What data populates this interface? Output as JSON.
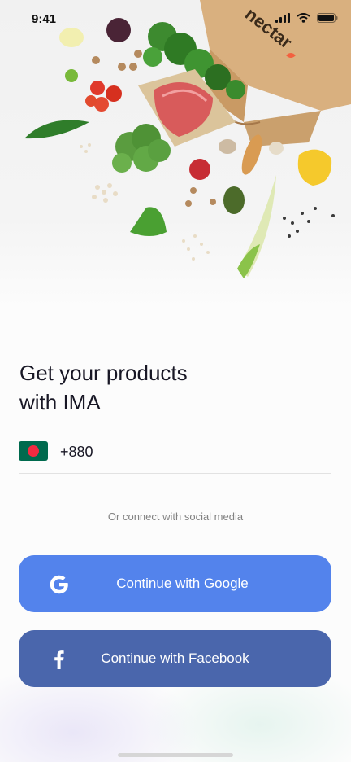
{
  "status_bar": {
    "time": "9:41"
  },
  "hero": {
    "brand": "nectar"
  },
  "headline": {
    "line1": "Get your products",
    "line2": "with IMA"
  },
  "phone": {
    "country": "Bangladesh",
    "dial_code": "+880"
  },
  "social": {
    "divider_text": "Or connect with social media",
    "google_label": "Continue with Google",
    "facebook_label": "Continue with Facebook"
  },
  "colors": {
    "google": "#5383ec",
    "facebook": "#4a66ac",
    "text": "#181725",
    "muted": "#828282"
  }
}
